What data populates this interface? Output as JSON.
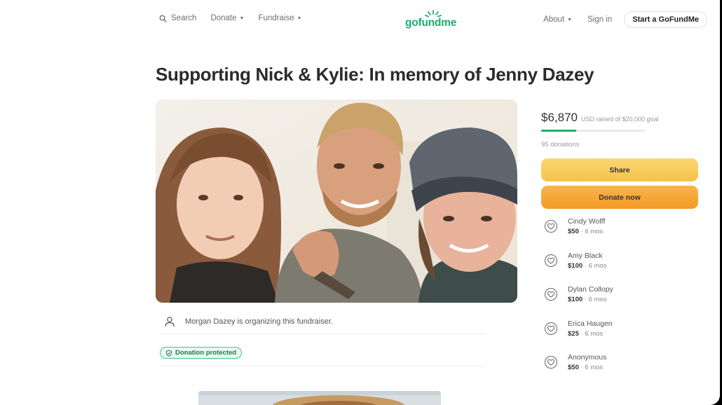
{
  "header": {
    "search_label": "Search",
    "donate_label": "Donate",
    "fundraise_label": "Fundraise",
    "logo_text": "gofundme",
    "about_label": "About",
    "signin_label": "Sign in",
    "start_label": "Start a GoFundMe",
    "brand_color": "#1fae6b"
  },
  "campaign": {
    "title": "Supporting Nick & Kylie: In memory of Jenny Dazey",
    "organizer_text": "Morgan Dazey is organizing this fundraiser.",
    "protected_label": "Donation protected"
  },
  "sidebar": {
    "amount": "$6,870",
    "raised_note": "USD raised of $20,000 goal",
    "progress_fraction": 0.34,
    "donation_count": "95 donations",
    "share_label": "Share",
    "donate_now_label": "Donate now",
    "donors": [
      {
        "name": "Cindy Wolff",
        "amount": "$50",
        "time": "6 mos"
      },
      {
        "name": "Amy Black",
        "amount": "$100",
        "time": "6 mos"
      },
      {
        "name": "Dylan Collopy",
        "amount": "$100",
        "time": "6 mos"
      },
      {
        "name": "Erica Haugen",
        "amount": "$25",
        "time": "6 mos"
      },
      {
        "name": "Anonymous",
        "amount": "$50",
        "time": "6 mos"
      }
    ]
  }
}
